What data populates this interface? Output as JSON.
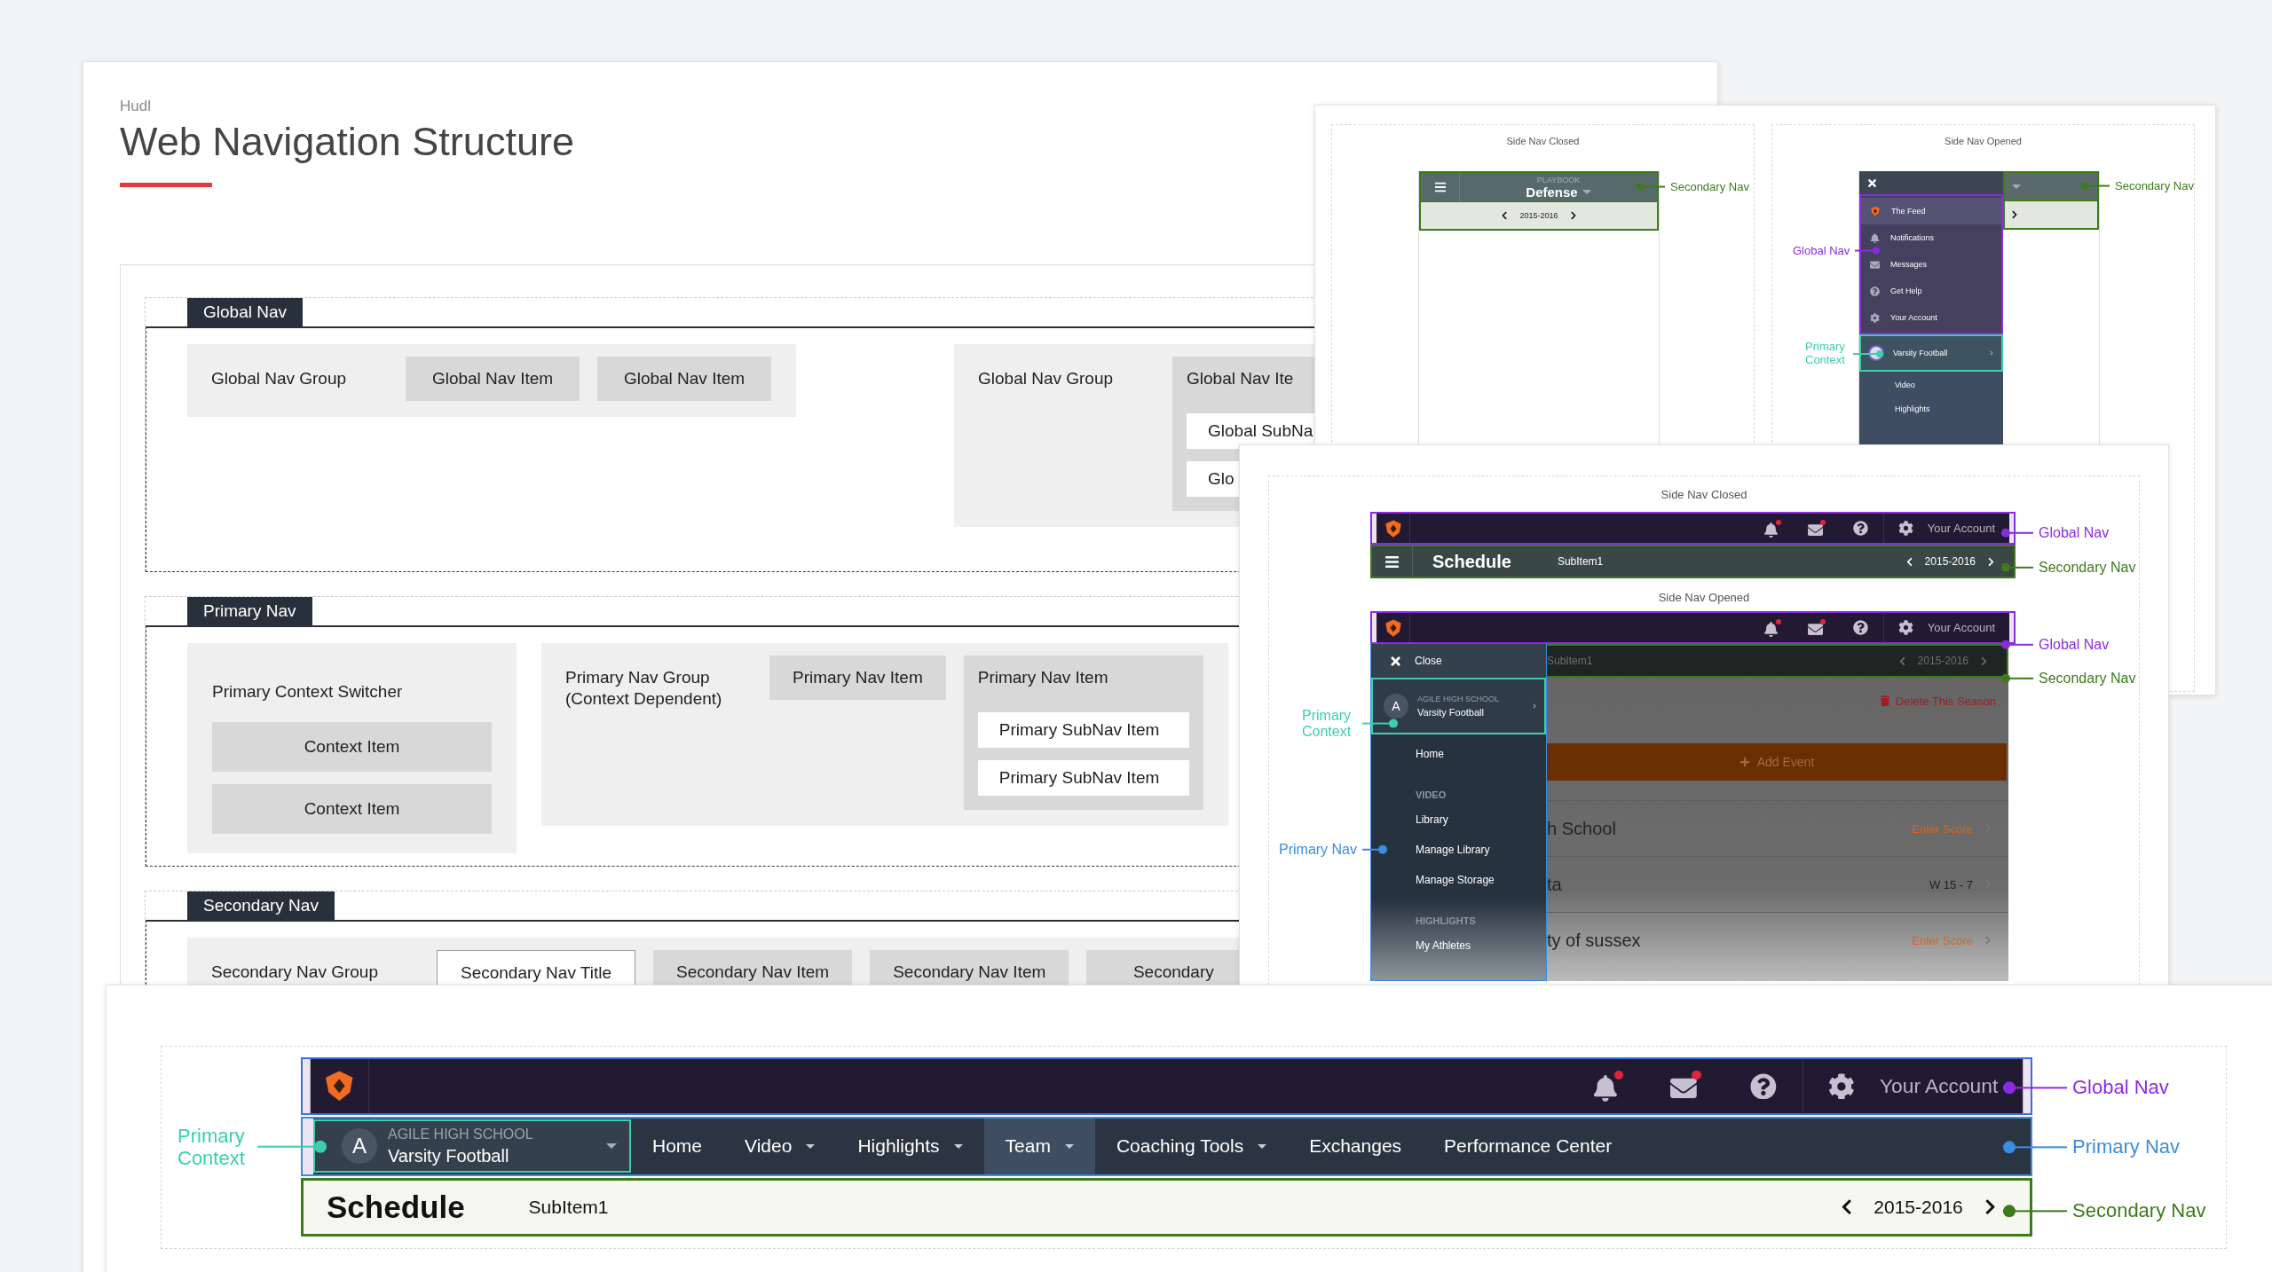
{
  "document": {
    "brand": "Hudl",
    "title": "Web Navigation Structure",
    "sections": [
      {
        "tag": "Global Nav",
        "groups": [
          {
            "kind": "row",
            "label": "Global Nav Group",
            "items": [
              {
                "label": "Global Nav Item"
              },
              {
                "label": "Global Nav Item"
              }
            ]
          },
          {
            "kind": "row",
            "label": "Global Nav Group",
            "items": [
              {
                "label": "Global Nav Ite",
                "children": [
                  {
                    "label": "Global SubNa"
                  },
                  {
                    "label": "Glo"
                  }
                ]
              }
            ]
          }
        ]
      },
      {
        "tag": "Primary Nav",
        "groups": [
          {
            "kind": "stack",
            "label": "Primary Context Switcher",
            "items": [
              {
                "label": "Context Item"
              },
              {
                "label": "Context Item"
              }
            ]
          },
          {
            "kind": "row",
            "label": "Primary Nav Group\n(Context Dependent)",
            "items": [
              {
                "label": "Primary Nav Item"
              },
              {
                "label": "Primary Nav Item",
                "children": [
                  {
                    "label": "Primary SubNav Item"
                  },
                  {
                    "label": "Primary SubNav Item"
                  }
                ]
              }
            ]
          }
        ]
      },
      {
        "tag": "Secondary Nav",
        "groups": [
          {
            "kind": "row",
            "label": "Secondary Nav Group",
            "items": [
              {
                "kind": "title",
                "label": "Secondary Nav Title"
              },
              {
                "kind": "item",
                "label": "Secondary Nav Item"
              },
              {
                "kind": "item",
                "label": "Secondary Nav Item"
              },
              {
                "kind": "item",
                "label": "Secondary"
              }
            ]
          }
        ]
      }
    ]
  },
  "mobile_board": {
    "closed": {
      "title": "Side Nav Closed",
      "context_label": "PLAYBOOK",
      "context": "Defense",
      "season": "2015-2016",
      "callouts": [
        {
          "kind": "secondary",
          "text": "Secondary Nav"
        }
      ]
    },
    "opened": {
      "title": "Side Nav Opened",
      "global_items": [
        {
          "label": "The Feed",
          "selected": true
        },
        {
          "label": "Notifications",
          "selected": false
        },
        {
          "label": "Messages",
          "selected": false
        },
        {
          "label": "Get Help",
          "selected": false
        },
        {
          "label": "Your Account",
          "selected": false
        }
      ],
      "context": "Varsity Football",
      "items": [
        "Video",
        "Highlights"
      ],
      "callouts": [
        {
          "kind": "secondary",
          "text": "Secondary Nav"
        },
        {
          "kind": "global",
          "text": "Global Nav"
        },
        {
          "kind": "context",
          "text": "Primary Context"
        }
      ]
    }
  },
  "desktop_board": {
    "closed": {
      "title": "Side Nav Closed",
      "account": "Your Account",
      "page_title": "Schedule",
      "subitem": "SubItem1",
      "season": "2015-2016",
      "callouts": [
        {
          "kind": "global",
          "text": "Global Nav"
        },
        {
          "kind": "secondary",
          "text": "Secondary Nav"
        }
      ]
    },
    "opened": {
      "title": "Side Nav Opened",
      "account": "Your Account",
      "subitem": "SubItem1",
      "season": "2015-2016",
      "close": "Close",
      "avatar": "A",
      "school": "AGILE HIGH SCHOOL",
      "team": "Varsity Football",
      "menu": [
        {
          "kind": "item",
          "label": "Home"
        },
        {
          "kind": "heading",
          "label": "VIDEO"
        },
        {
          "kind": "item",
          "label": "Library"
        },
        {
          "kind": "item",
          "label": "Manage Library"
        },
        {
          "kind": "item",
          "label": "Manage Storage"
        },
        {
          "kind": "heading",
          "label": "HIGHLIGHTS"
        },
        {
          "kind": "item",
          "label": "My Athletes"
        }
      ],
      "delete": "Delete This Season",
      "add": "Add Event",
      "rows": [
        {
          "kind": "action",
          "name": "h School",
          "result": "Enter Score"
        },
        {
          "kind": "score",
          "name": "ta",
          "result": "W 15 - 7"
        },
        {
          "kind": "action",
          "name": "ty of sussex",
          "result": "Enter Score"
        }
      ],
      "callouts": [
        {
          "kind": "global",
          "text": "Global Nav"
        },
        {
          "kind": "secondary",
          "text": "Secondary Nav"
        },
        {
          "kind": "context",
          "text": "Primary Context"
        },
        {
          "kind": "primary",
          "text": "Primary Nav"
        }
      ]
    }
  },
  "header_board": {
    "account": "Your Account",
    "avatar": "A",
    "school": "AGILE HIGH SCHOOL",
    "team": "Varsity Football",
    "nav": [
      {
        "label": "Home",
        "dropdown": false,
        "selected": false
      },
      {
        "label": "Video",
        "dropdown": true,
        "selected": false
      },
      {
        "label": "Highlights",
        "dropdown": true,
        "selected": false
      },
      {
        "label": "Team",
        "dropdown": true,
        "selected": true
      },
      {
        "label": "Coaching Tools",
        "dropdown": true,
        "selected": false
      },
      {
        "label": "Exchanges",
        "dropdown": false,
        "selected": false
      },
      {
        "label": "Performance Center",
        "dropdown": false,
        "selected": false
      }
    ],
    "page_title": "Schedule",
    "subitem": "SubItem1",
    "season": "2015-2016",
    "callouts": [
      {
        "kind": "context",
        "text": "Primary Context"
      },
      {
        "kind": "global",
        "text": "Global Nav"
      },
      {
        "kind": "primary",
        "text": "Primary Nav"
      },
      {
        "kind": "secondary",
        "text": "Secondary Nav"
      }
    ]
  }
}
